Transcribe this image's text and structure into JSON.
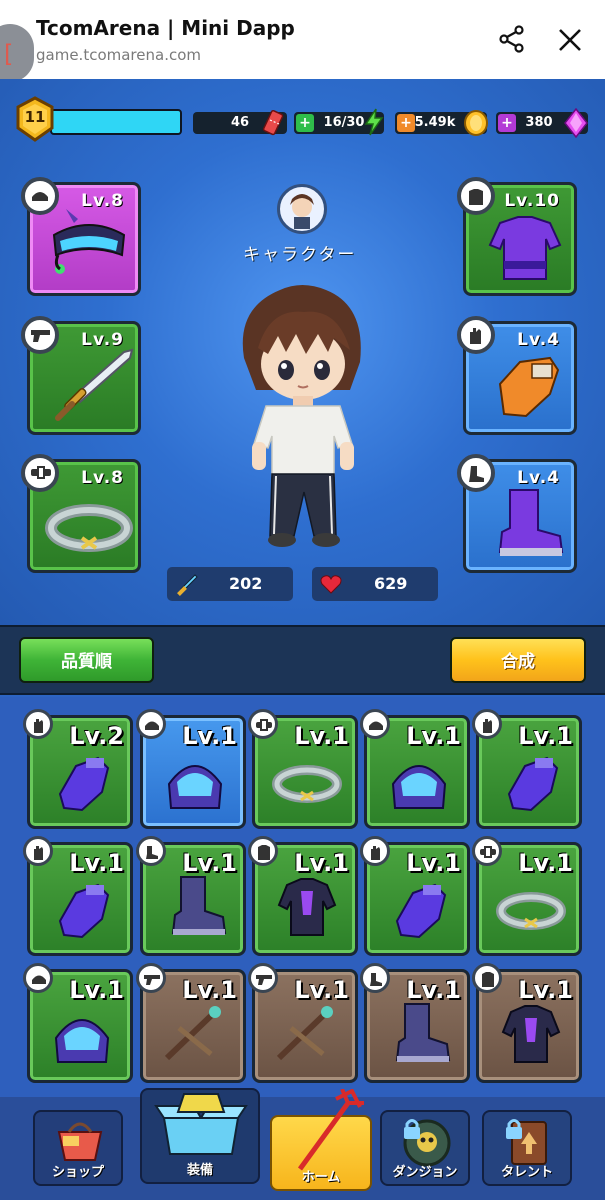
{
  "header": {
    "badge": "[",
    "title": "TcomArena | Mini Dapp",
    "url": "game.tcomarena.com",
    "share_icon": "share-icon",
    "close_icon": "close-icon"
  },
  "stats": {
    "level": "11",
    "xp_fraction": 1.0,
    "tickets": "46",
    "energy": "16/30",
    "gold": "5.49k",
    "gems": "380"
  },
  "equipment": {
    "left": [
      {
        "type": "headgear",
        "level": "Lv.8",
        "rarity": "pink"
      },
      {
        "type": "weapon",
        "level": "Lv.9",
        "rarity": "green"
      },
      {
        "type": "belt",
        "level": "Lv.8",
        "rarity": "green"
      }
    ],
    "right": [
      {
        "type": "armor",
        "level": "Lv.10",
        "rarity": "green"
      },
      {
        "type": "gloves",
        "level": "Lv.4",
        "rarity": "blue"
      },
      {
        "type": "boots",
        "level": "Lv.4",
        "rarity": "blue"
      }
    ]
  },
  "character": {
    "label": "キャラクター",
    "attack": "202",
    "hp": "629"
  },
  "actions": {
    "sort_label": "品質順",
    "merge_label": "合成"
  },
  "inventory": [
    {
      "type": "gloves",
      "level": "Lv.2",
      "rarity": "green"
    },
    {
      "type": "headgear",
      "level": "Lv.1",
      "rarity": "blue"
    },
    {
      "type": "belt",
      "level": "Lv.1",
      "rarity": "green"
    },
    {
      "type": "headgear",
      "level": "Lv.1",
      "rarity": "green"
    },
    {
      "type": "gloves",
      "level": "Lv.1",
      "rarity": "green"
    },
    {
      "type": "gloves",
      "level": "Lv.1",
      "rarity": "green"
    },
    {
      "type": "boots",
      "level": "Lv.1",
      "rarity": "green"
    },
    {
      "type": "armor",
      "level": "Lv.1",
      "rarity": "green"
    },
    {
      "type": "gloves",
      "level": "Lv.1",
      "rarity": "green"
    },
    {
      "type": "belt",
      "level": "Lv.1",
      "rarity": "green"
    },
    {
      "type": "headgear",
      "level": "Lv.1",
      "rarity": "green"
    },
    {
      "type": "weapon",
      "level": "Lv.1",
      "rarity": "brown"
    },
    {
      "type": "weapon",
      "level": "Lv.1",
      "rarity": "brown"
    },
    {
      "type": "boots",
      "level": "Lv.1",
      "rarity": "brown"
    },
    {
      "type": "armor",
      "level": "Lv.1",
      "rarity": "brown"
    }
  ],
  "nav": [
    {
      "label": "ショップ",
      "icon": "shop-basket-icon",
      "locked": false
    },
    {
      "label": "装備",
      "icon": "equipment-box-icon",
      "locked": false
    },
    {
      "label": "ホーム",
      "icon": "trident-home-icon",
      "locked": false
    },
    {
      "label": "ダンジョン",
      "icon": "dungeon-skull-icon",
      "locked": true
    },
    {
      "label": "タレント",
      "icon": "talent-book-icon",
      "locked": true
    }
  ],
  "colors": {
    "accent_yellow": "#ffc21b",
    "accent_green": "#3fb437",
    "xp_cyan": "#2fd6f5",
    "background_blue": "#2c64c2"
  }
}
